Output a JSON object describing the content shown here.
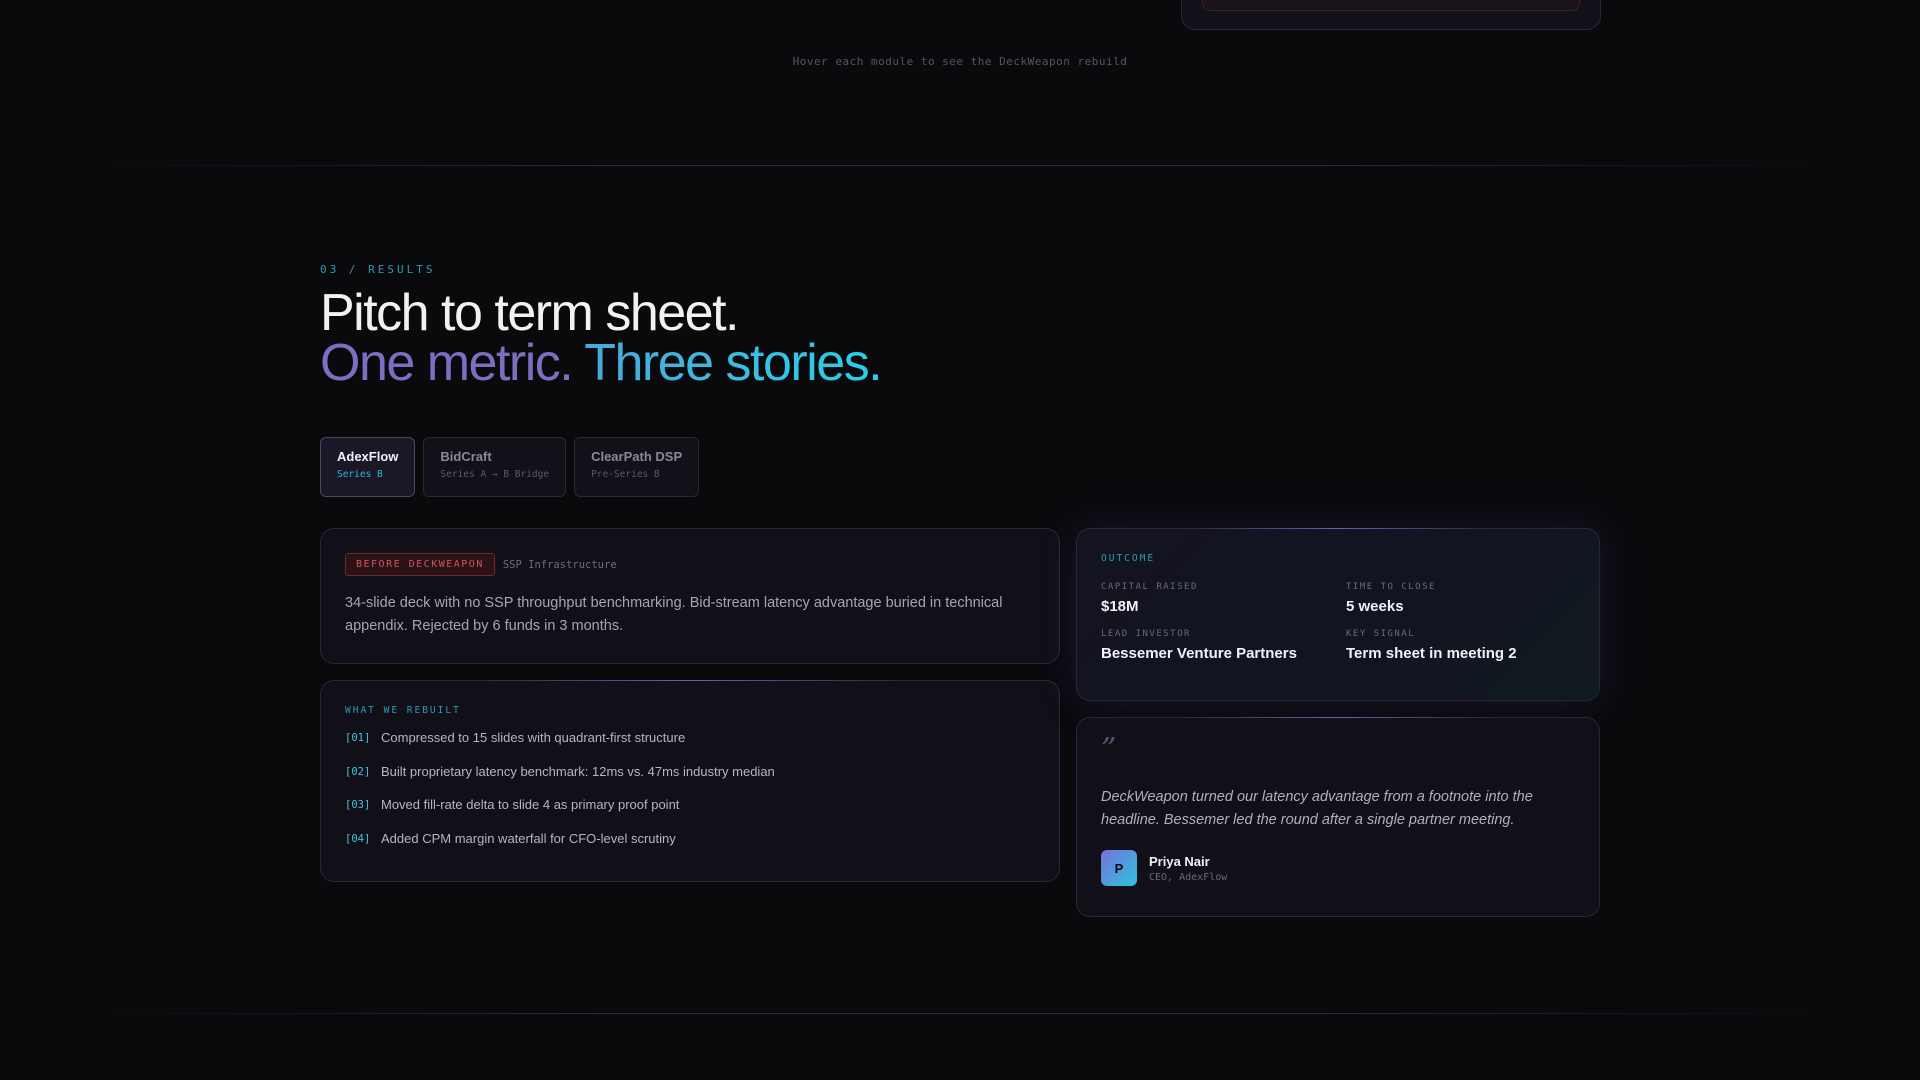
{
  "hover_hint": "Hover each module to see the DeckWeapon rebuild",
  "section": {
    "eyebrow": "03 / RESULTS",
    "headline_line1": "Pitch to term sheet.",
    "headline_line2_a": "One metric.",
    "headline_line2_b": "Three stories."
  },
  "tabs": [
    {
      "name": "AdexFlow",
      "sub": "Series B",
      "active": true
    },
    {
      "name": "BidCraft",
      "sub": "Series A → B Bridge",
      "active": false
    },
    {
      "name": "ClearPath DSP",
      "sub": "Pre-Series B",
      "active": false
    }
  ],
  "before": {
    "badge": "BEFORE DECKWEAPON",
    "tag": "SSP Infrastructure",
    "text": "34-slide deck with no SSP throughput benchmarking. Bid-stream latency advantage buried in technical appendix. Rejected by 6 funds in 3 months."
  },
  "rebuilt": {
    "eyebrow": "WHAT WE REBUILT",
    "steps": [
      {
        "num": "[01]",
        "text": "Compressed to 15 slides with quadrant-first structure"
      },
      {
        "num": "[02]",
        "text": "Built proprietary latency benchmark: 12ms vs. 47ms industry median"
      },
      {
        "num": "[03]",
        "text": "Moved fill-rate delta to slide 4 as primary proof point"
      },
      {
        "num": "[04]",
        "text": "Added CPM margin waterfall for CFO-level scrutiny"
      }
    ]
  },
  "outcome": {
    "eyebrow": "OUTCOME",
    "metrics": [
      {
        "label": "CAPITAL RAISED",
        "value": "$18M"
      },
      {
        "label": "TIME TO CLOSE",
        "value": "5 weeks"
      },
      {
        "label": "LEAD INVESTOR",
        "value": "Bessemer Venture Partners"
      },
      {
        "label": "KEY SIGNAL",
        "value": "Term sheet in meeting 2"
      }
    ]
  },
  "quote": {
    "mark": "”",
    "text": "DeckWeapon turned our latency advantage from a footnote into the headline. Bessemer led the round after a single partner meeting.",
    "avatar_initial": "P",
    "name": "Priya Nair",
    "role": "CEO, AdexFlow"
  },
  "colors": {
    "accent_cyan": "#2bd0e8",
    "accent_violet": "#7a6fc0",
    "danger": "#d0555d",
    "background": "#0a0a0d"
  }
}
